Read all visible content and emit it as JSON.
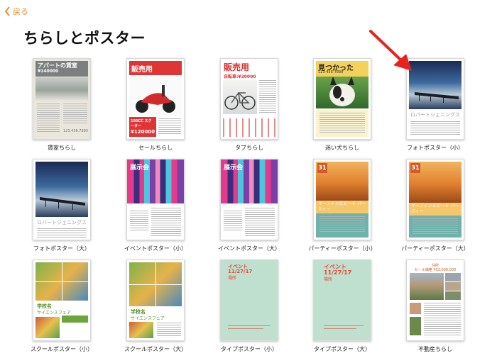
{
  "nav": {
    "back_label": "戻る"
  },
  "page_title": "ちらしとポスター",
  "templates": [
    {
      "label": "賃家ちらし",
      "thumb": {
        "heading": "アパートの賃室",
        "price": "¥140000",
        "phone": "123.456.7890"
      }
    },
    {
      "label": "セールちらし",
      "thumb": {
        "heading": "販売用",
        "tagline": "100CC スクーター",
        "price": "¥120000"
      }
    },
    {
      "label": "タブちらし",
      "thumb": {
        "heading": "販売用",
        "subheading": "自転車:¥30000"
      }
    },
    {
      "label": "迷い犬ちらし",
      "thumb": {
        "heading": "見つかった",
        "phone": "123-456-7890"
      }
    },
    {
      "label": "フォトポスター（小）",
      "thumb": {
        "heading": "ロバートジェニングス"
      }
    },
    {
      "label": "フォトポスター（大）",
      "thumb": {
        "heading": "ロバートジェニングス"
      }
    },
    {
      "label": "イベントポスター（小）",
      "thumb": {
        "heading": "展示会"
      }
    },
    {
      "label": "イベントポスター（大）",
      "thumb": {
        "heading": "展示会"
      }
    },
    {
      "label": "パーティーポスター（小）",
      "thumb": {
        "date": "31",
        "heading": "サーフィンとビーチ パーティー"
      }
    },
    {
      "label": "パーティーポスター（大）",
      "thumb": {
        "date": "31",
        "heading": "サーフィンとビーチ パーティー"
      }
    },
    {
      "label": "スクールポスター（小）",
      "thumb": {
        "heading": "学校名",
        "subheading": "サイエンスフェア"
      }
    },
    {
      "label": "スクールポスター（大）",
      "thumb": {
        "heading": "学校名",
        "subheading": "サイエンスフェア"
      }
    },
    {
      "label": "タイプポスター（小）",
      "thumb": {
        "heading": "イベント",
        "date": "11/27/17",
        "place": "場所"
      }
    },
    {
      "label": "タイプポスター（大）",
      "thumb": {
        "heading": "イベント",
        "date": "11/27/17",
        "place": "場所"
      }
    },
    {
      "label": "不動産ちらし",
      "thumb": {
        "heading": "住所",
        "price": "セール価格 ¥53,000,000"
      }
    }
  ],
  "colors": {
    "accent": "#e8902a",
    "annotation_arrow": "#e8231f"
  },
  "icons": {
    "back": "chevron-left-icon",
    "annotation": "red-arrow-icon"
  }
}
